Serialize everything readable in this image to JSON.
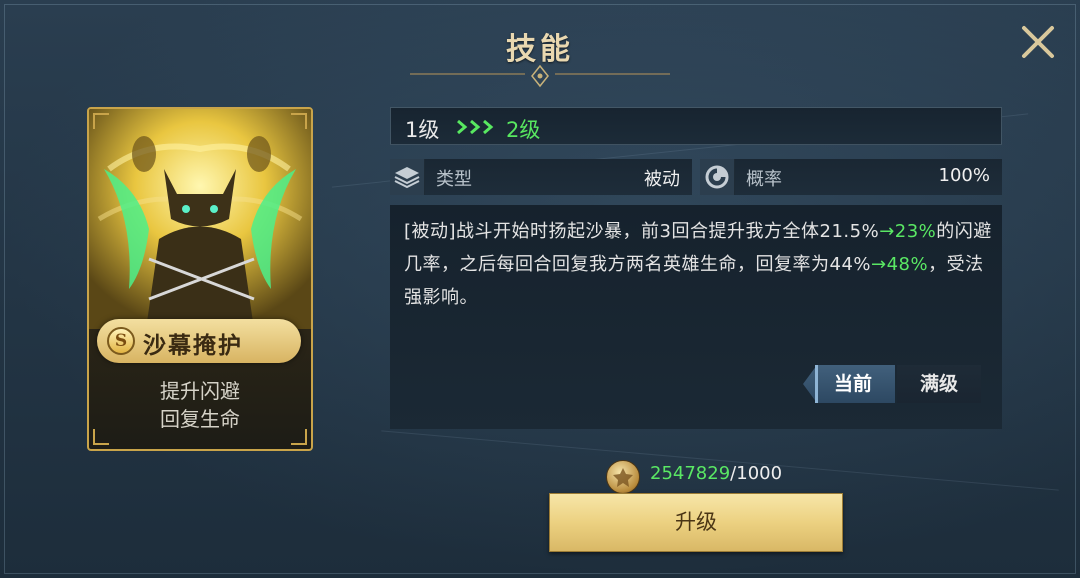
{
  "window": {
    "title": "技能"
  },
  "card": {
    "rank": "S",
    "name": "沙幕掩护",
    "desc_line1": "提升闪避",
    "desc_line2": "回复生命"
  },
  "level": {
    "current": "1级",
    "next": "2级"
  },
  "stats": {
    "type": {
      "icon": "layers-icon",
      "label": "类型",
      "value": "被动"
    },
    "rate": {
      "icon": "pie-chart-icon",
      "label": "概率",
      "value": "100%"
    }
  },
  "description": {
    "p1": "[被动]战斗开始时扬起沙暴，前3回合提升我方全体21.5%",
    "p2": "→23%",
    "p3": "的闪避几率，之后每回合回复我方两名英雄生命，回复率为44%",
    "p4": "→48%",
    "p5": "，受法强影响。"
  },
  "tabs": {
    "current": "当前",
    "max": "满级"
  },
  "cost": {
    "have": "2547829",
    "sep": "/",
    "need": "1000",
    "icon": "coin-icon"
  },
  "upgrade": {
    "label": "升级"
  },
  "colors": {
    "green": "#5ae864",
    "gold": "#e9d8b0",
    "panel": "#233545"
  }
}
